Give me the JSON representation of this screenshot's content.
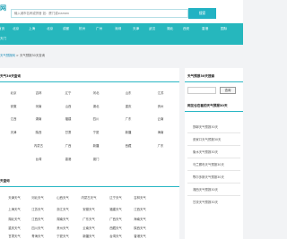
{
  "header": {
    "logo": "网",
    "search_placeholder": "输入城市名称或拼音 如：厦门或xiamen",
    "search_button": "搜索"
  },
  "nav": {
    "row1": [
      "首页",
      "北京",
      "上海",
      "北京",
      "成都",
      "杭州",
      "广州",
      "深圳",
      "天津",
      "武汉",
      "湖北",
      "西安",
      "香港",
      "国际"
    ],
    "row2": [
      "天门"
    ]
  },
  "breadcrumb": {
    "link": "天气预报网",
    "sep": ">",
    "current": "天气预报30天查询"
  },
  "provinces": {
    "title": "天气30天查询",
    "rows": [
      [
        "北京",
        "吉林",
        "辽宁",
        "河北",
        "山东",
        "江苏"
      ],
      [
        "安徽",
        "河南",
        "山西",
        "湖北",
        "重庆",
        "贵州"
      ],
      [
        "江西",
        "湖南",
        "福建",
        "四川",
        "广东",
        "云南"
      ],
      [
        "天津",
        "陕西",
        "甘肃",
        "宁夏",
        "新疆",
        "海南"
      ],
      [
        "内蒙古",
        "广西",
        "新疆",
        "西藏",
        "广东"
      ],
      [
        "台湾",
        "香港",
        "澳门"
      ]
    ]
  },
  "cities": {
    "title": "天查询",
    "rows": [
      [
        "天津天气",
        "河北天气",
        "山西天气",
        "内蒙古天气",
        "辽宁天气",
        "吉林天气"
      ],
      [
        "上海天气",
        "江苏天气",
        "浙江天气",
        "安徽天气",
        "福建天气",
        "江西天气"
      ],
      [
        "湖北天气",
        "江西天气",
        "湖南天气",
        "广东天气",
        "广西天气",
        "海南天气"
      ],
      [
        "重庆天气",
        "四川天气",
        "贵州天气",
        "云南天气",
        "西藏天气",
        "陕西天气"
      ],
      [
        "甘肃天气",
        "青海天气",
        "宁夏天气",
        "新疆天气",
        "台湾天气",
        "香港天气"
      ]
    ]
  },
  "sidebar": {
    "search_title": "天气预报30天搜索",
    "search_button": "查询",
    "hot_title": "网友也在看的天气预报30天",
    "links": [
      "邯郸天气预报30天",
      "张家口天气预报30天",
      "衡水天气预报30天",
      "乌兰察布天气预报30天",
      "鄂尔多斯天气预报30天",
      "湘西天气预报30天",
      "甘孜天气预报30天"
    ]
  }
}
